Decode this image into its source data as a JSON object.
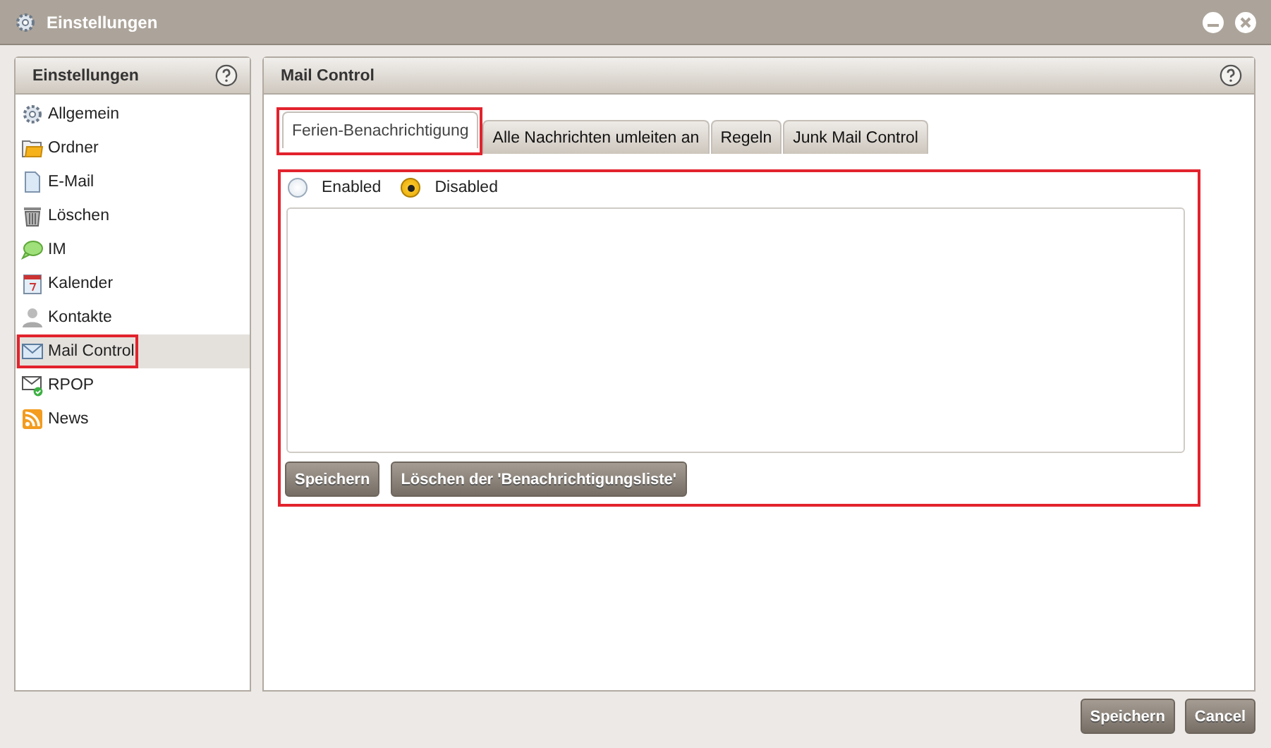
{
  "window": {
    "title": "Einstellungen"
  },
  "sidebar": {
    "title": "Einstellungen",
    "items": [
      {
        "label": "Allgemein",
        "selected": false,
        "highlighted": false
      },
      {
        "label": "Ordner",
        "selected": false,
        "highlighted": false
      },
      {
        "label": "E-Mail",
        "selected": false,
        "highlighted": false
      },
      {
        "label": "Löschen",
        "selected": false,
        "highlighted": false
      },
      {
        "label": "IM",
        "selected": false,
        "highlighted": false
      },
      {
        "label": "Kalender",
        "selected": false,
        "highlighted": false
      },
      {
        "label": "Kontakte",
        "selected": false,
        "highlighted": false
      },
      {
        "label": "Mail Control",
        "selected": true,
        "highlighted": true
      },
      {
        "label": "RPOP",
        "selected": false,
        "highlighted": false
      },
      {
        "label": "News",
        "selected": false,
        "highlighted": false
      }
    ]
  },
  "main": {
    "title": "Mail Control",
    "tabs": [
      {
        "label": "Ferien-Benachrichtigung",
        "selected": true,
        "highlighted": true
      },
      {
        "label": "Alle Nachrichten umleiten an",
        "selected": false,
        "highlighted": false
      },
      {
        "label": "Regeln",
        "selected": false,
        "highlighted": false
      },
      {
        "label": "Junk Mail Control",
        "selected": false,
        "highlighted": false
      }
    ],
    "form": {
      "highlighted": true,
      "radios": [
        {
          "label": "Enabled",
          "selected": false
        },
        {
          "label": "Disabled",
          "selected": true
        }
      ],
      "buttons": [
        "Speichern",
        "Löschen der 'Benachrichtigungsliste'"
      ]
    }
  },
  "footer_buttons": [
    "Speichern",
    "Cancel"
  ]
}
